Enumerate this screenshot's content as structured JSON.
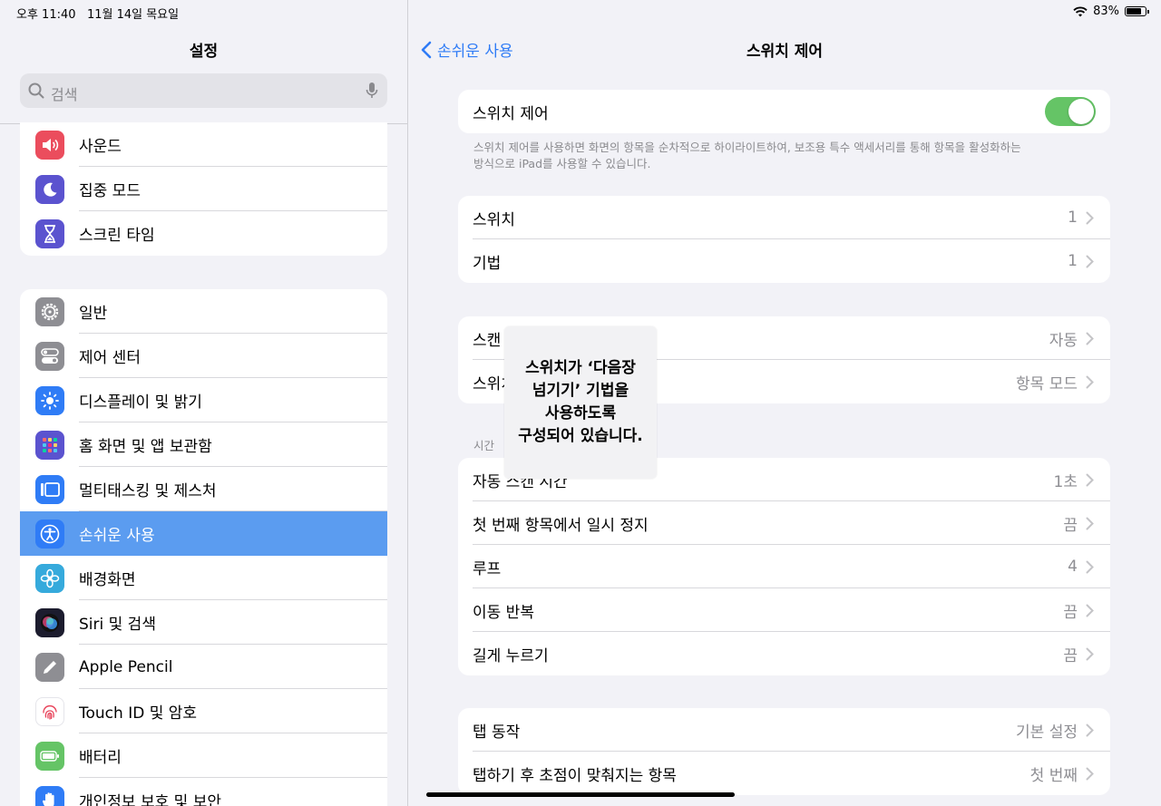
{
  "status": {
    "time": "오후 11:40",
    "date": "11월 14일 목요일",
    "battery": "83%",
    "battery_level": 0.83
  },
  "sidebar": {
    "title": "설정",
    "search_placeholder": "검색",
    "group1": [
      {
        "label": "사운드",
        "color": "#eb4d5d"
      },
      {
        "label": "집중 모드",
        "color": "#5b53cf"
      },
      {
        "label": "스크린 타임",
        "color": "#5b53cf"
      }
    ],
    "group2": [
      {
        "label": "일반",
        "color": "#8e8e93"
      },
      {
        "label": "제어 센터",
        "color": "#8e8e93"
      },
      {
        "label": "디스플레이 및 밝기",
        "color": "#2f7cf6"
      },
      {
        "label": "홈 화면 및 앱 보관함",
        "color": "#5b53cf"
      },
      {
        "label": "멀티태스킹 및 제스처",
        "color": "#2f7cf6"
      },
      {
        "label": "손쉬운 사용",
        "color": "#2f7cf6"
      },
      {
        "label": "배경화면",
        "color": "#36aadc"
      },
      {
        "label": "Siri 및 검색",
        "color": "#1c1c2e"
      },
      {
        "label": "Apple Pencil",
        "color": "#8e8e93"
      },
      {
        "label": "Touch ID 및 암호",
        "color": "#ffffff"
      },
      {
        "label": "배터리",
        "color": "#65c466"
      },
      {
        "label": "개인정보 보호 및 보안",
        "color": "#2f7cf6"
      }
    ]
  },
  "nav": {
    "back": "손쉬운 사용",
    "title": "스위치 제어"
  },
  "main": {
    "toggle_row": {
      "label": "스위치 제어",
      "on": true
    },
    "footnote_1": "스위치 제어를 사용하면 화면의 항목을 순차적으로 하이라이트하여, 보조용 특수 액세서리를 통해 항목을 활성화하는",
    "footnote_2": "방식으로 iPad를 사용할 수 있습니다.",
    "card1": [
      {
        "label": "스위치",
        "value": "1"
      },
      {
        "label": "기법",
        "value": "1"
      }
    ],
    "card2": [
      {
        "label": "스캔",
        "value": "자동"
      },
      {
        "label": "스위치",
        "value": "항목 모드"
      }
    ],
    "section_time": "시간",
    "card3": [
      {
        "label": "자동 스캔 시간",
        "value": "1초"
      },
      {
        "label": "첫 번째 항목에서 일시 정지",
        "value": "끔"
      },
      {
        "label": "루프",
        "value": "4"
      },
      {
        "label": "이동 반복",
        "value": "끔"
      },
      {
        "label": "길게 누르기",
        "value": "끔"
      }
    ],
    "card4": [
      {
        "label": "탭 동작",
        "value": "기본 설정"
      },
      {
        "label": "탭하기 후 초점이 맞춰지는 항목",
        "value": "첫 번째"
      }
    ]
  },
  "popup": {
    "line1": "스위치가 ‘다음장",
    "line2": "넘기기’ 기법을",
    "line3": "사용하도록",
    "line4": "구성되어 있습니다."
  }
}
